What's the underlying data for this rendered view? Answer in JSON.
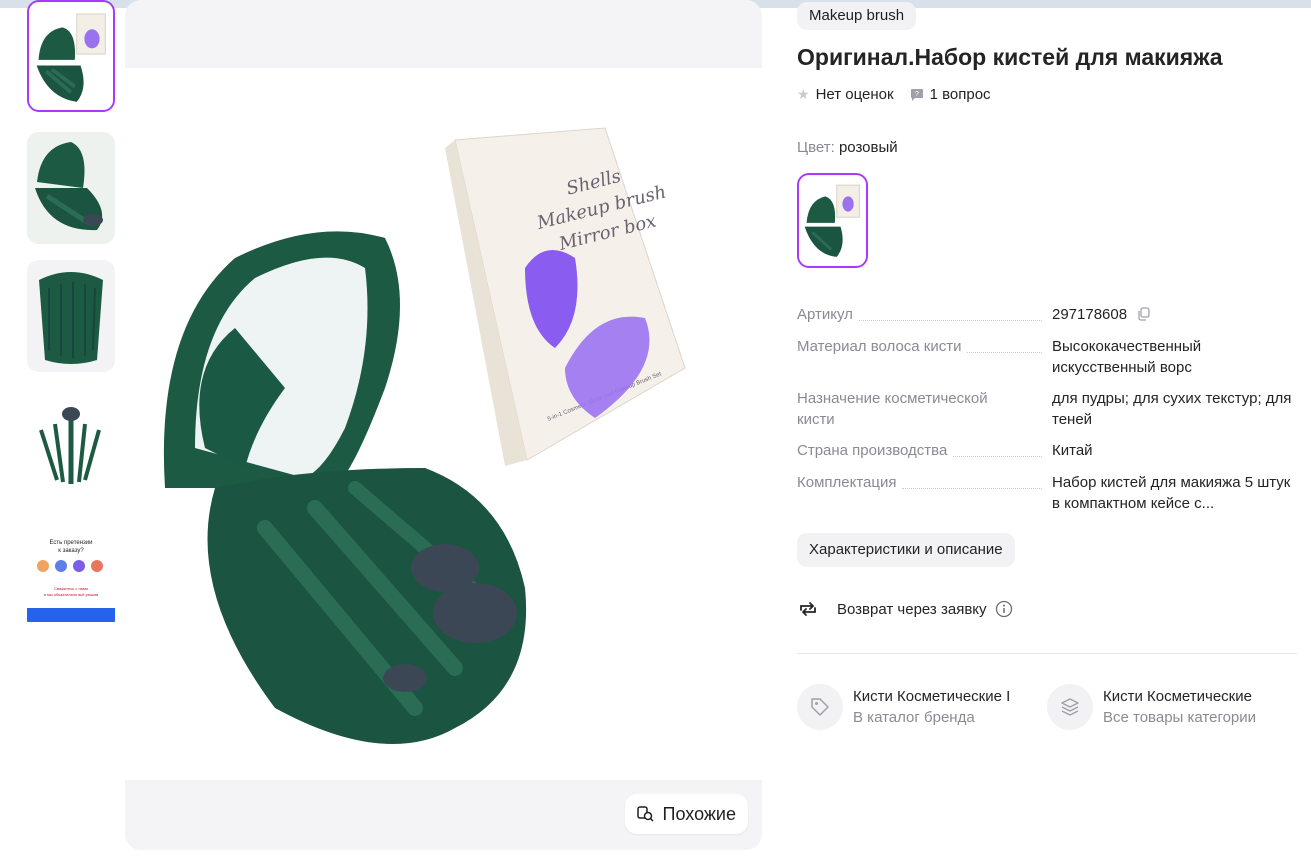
{
  "brand_chip": "Makeup brush",
  "title": "Оригинал.Набор кистей для макияжа",
  "meta": {
    "rating_text": "Нет оценок",
    "questions_text": "1 вопрос"
  },
  "color": {
    "label": "Цвет:",
    "value": "розовый"
  },
  "box_text": {
    "line1": "Shells",
    "line2": "Makeup brush",
    "line3": "Mirror box",
    "bottom": "5-in-1 Cosmetic Mirror and Makeup Brush Set"
  },
  "thumb5_text": {
    "heading": "Есть претензии к заказу?",
    "line1": "Свяжитесь с нами",
    "line2": "и мы обязательно всё решим"
  },
  "specs": [
    {
      "key": "Артикул",
      "value": "297178608"
    },
    {
      "key": "Материал волоса кисти",
      "value": "Высококачественный искусственный ворс"
    },
    {
      "key": "Назначение косметической кисти",
      "value": "для пудры; для сухих текстур; для теней"
    },
    {
      "key": "Страна производства",
      "value": "Китай"
    },
    {
      "key": "Комплектация",
      "value": "Набор кистей для макияжа 5 штук в компактном кейсе с..."
    }
  ],
  "description_button": "Характеристики и описание",
  "return_text": "Возврат через заявку",
  "similar_button": "Похожие",
  "links": [
    {
      "title": "Кисти Косметические I",
      "subtitle": "В каталог бренда"
    },
    {
      "title": "Кисти Косметические",
      "subtitle": "Все товары категории"
    }
  ],
  "colors": {
    "accent": "#a73afd",
    "product_green": "#1d5a43",
    "box_purple": "#8a5cf0"
  }
}
